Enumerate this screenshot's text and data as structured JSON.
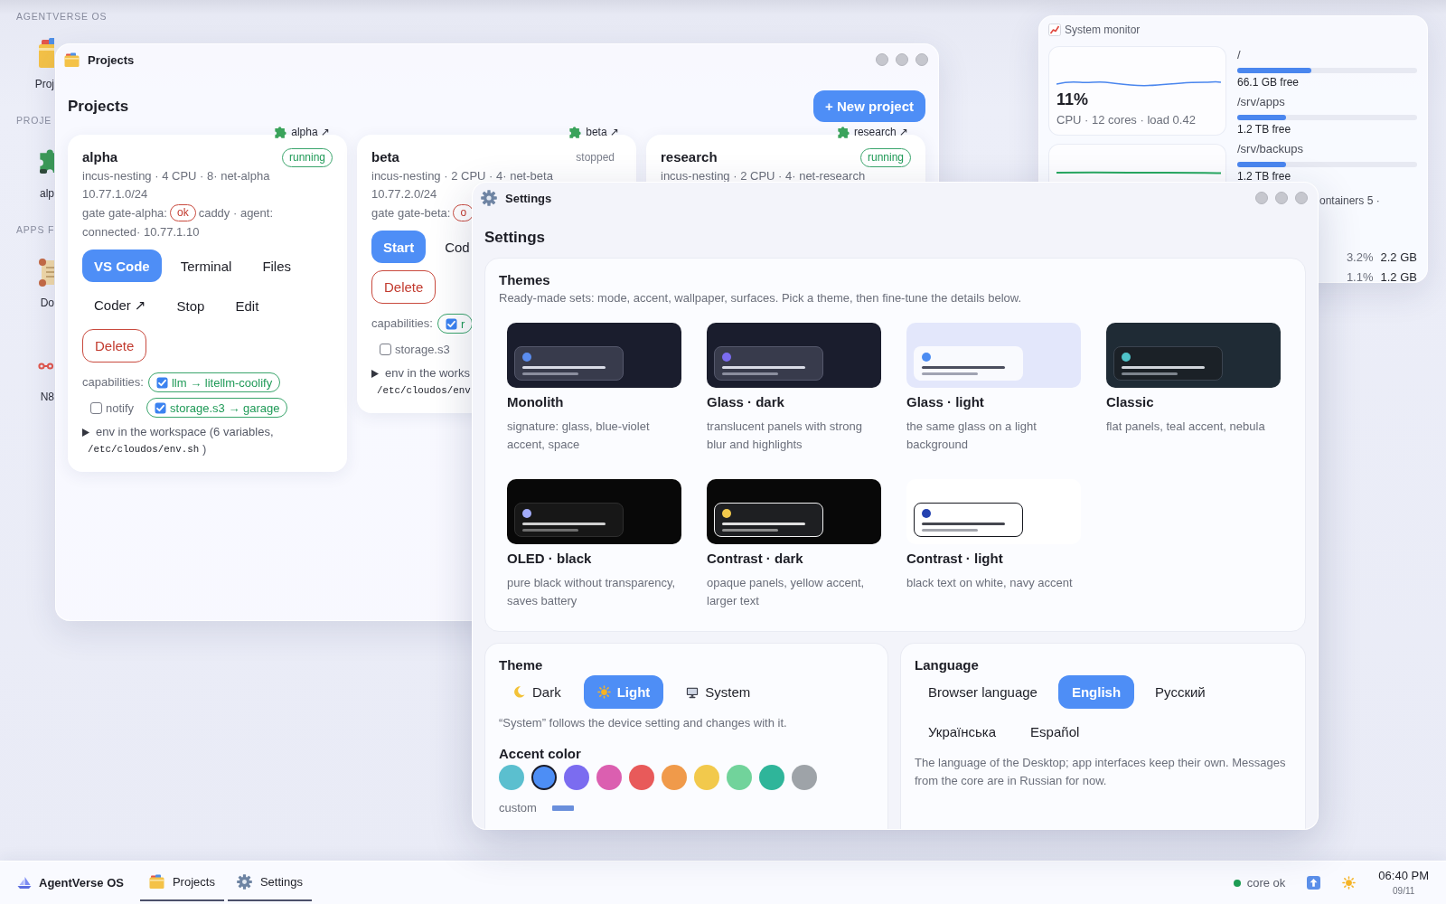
{
  "desktop": {
    "title": "AGENTVERSE OS",
    "entries": [
      {
        "kind": "folder",
        "label": "Proj"
      },
      {
        "kind": "heading",
        "label": "PROJE"
      },
      {
        "kind": "puzzle",
        "label": "alp"
      },
      {
        "kind": "heading",
        "label": "APPS F"
      },
      {
        "kind": "scroll",
        "label": "Do"
      },
      {
        "kind": "nodes",
        "label": "N8"
      }
    ]
  },
  "projects_window": {
    "title": "Projects",
    "heading": "Projects",
    "new_button": "+ New project",
    "projects": [
      {
        "name": "alpha",
        "link": "alpha ↗",
        "status": {
          "label": "running",
          "running": true
        },
        "specs": "incus-nesting · 4 CPU · 8· net-alpha",
        "subnet": "10.77.1.0/24",
        "gate": {
          "label": "gate gate-alpha:",
          "status": "ok",
          "details": [
            "caddy · agent:",
            "connected· 10.77.1.10"
          ]
        },
        "actions": [
          {
            "label": "VS Code",
            "kind": "primary"
          },
          {
            "label": "Terminal",
            "kind": "plain"
          },
          {
            "label": "Files",
            "kind": "plain"
          },
          {
            "label": "Coder ↗",
            "kind": "plain"
          },
          {
            "label": "Stop",
            "kind": "plain"
          },
          {
            "label": "Edit",
            "kind": "plain"
          },
          {
            "label": "Delete",
            "kind": "danger"
          }
        ],
        "capabilities": {
          "label": "capabilities:",
          "items": [
            {
              "label": "llm → litellm-coolify",
              "checked": true
            },
            {
              "label": "notify",
              "checked": false
            },
            {
              "label": "storage.s3 → garage",
              "checked": true
            }
          ]
        },
        "env": {
          "summary": "env in the workspace (6 variables,",
          "path": "/etc/cloudos/env.sh",
          "tail": ")",
          "expanded": false
        }
      },
      {
        "name": "beta",
        "link": "beta ↗",
        "status": {
          "label": "stopped",
          "running": false
        },
        "specs": "incus-nesting · 2 CPU · 4· net-beta",
        "subnet": "10.77.2.0/24",
        "gate": {
          "label": "gate gate-beta:",
          "status": "o"
        },
        "actions": [
          {
            "label": "Start",
            "kind": "primary"
          },
          {
            "label": "Cod",
            "kind": "plain"
          },
          {
            "label": "Delete",
            "kind": "danger"
          }
        ],
        "capabilities": {
          "label": "capabilities:",
          "items": [
            {
              "label": "r",
              "checked": true
            },
            {
              "label": "storage.s3",
              "checked": false
            }
          ]
        },
        "env": {
          "summary": "env in the works",
          "path": "/etc/cloudos/env",
          "expanded": false
        }
      },
      {
        "name": "research",
        "link": "research ↗",
        "status": {
          "label": "running",
          "running": true
        },
        "specs": "incus-nesting · 2 CPU · 4· net-research"
      }
    ]
  },
  "monitor": {
    "title": "System monitor",
    "cpu": {
      "value": "11%",
      "caption": "CPU · 12 cores · load 0.42"
    },
    "disks": [
      {
        "path": "/",
        "level": 0.41,
        "free": "66.1 GB free"
      },
      {
        "path": "/srv/apps",
        "level": 0.27,
        "free": "1.2 TB free"
      },
      {
        "path": "/srv/backups",
        "level": 0.27,
        "free": "1.2 TB free"
      }
    ],
    "containers": "ontainers 5 ·",
    "rows": [
      {
        "cells": [
          "3.2%",
          "2.2 GB"
        ]
      },
      {
        "cells": [
          "1.1%",
          "1.2 GB"
        ]
      }
    ]
  },
  "settings_window": {
    "title": "Settings",
    "heading": "Settings",
    "themes": {
      "title": "Themes",
      "description": "Ready-made sets: mode, accent, wallpaper, surfaces. Pick a theme, then fine-tune the details below.",
      "items": [
        {
          "name": "Monolith",
          "description": "signature: glass, blue-violet accent, space",
          "kind": "dark",
          "color": "#5b8def"
        },
        {
          "name": "Glass · dark",
          "description": "translucent panels with strong blur and highlights",
          "kind": "dark",
          "color": "#7b6cf0"
        },
        {
          "name": "Glass · light",
          "description": "the same glass on a light background",
          "kind": "light",
          "color": "#4c8cf2"
        },
        {
          "name": "Classic",
          "description": "flat panels, teal accent, nebula",
          "kind": "slate",
          "color": "#4fc3c9"
        },
        {
          "name": "OLED · black",
          "description": "pure black without transparency, saves battery",
          "kind": "black",
          "color": "#a3acfa"
        },
        {
          "name": "Contrast · dark",
          "description": "opaque panels, yellow accent, larger text",
          "kind": "contrast",
          "color": "#f2c94c"
        },
        {
          "name": "Contrast · light",
          "description": "black text on white, navy accent",
          "kind": "paper",
          "color": "#2341b0"
        }
      ]
    },
    "theme": {
      "title": "Theme",
      "options": [
        {
          "label": "Dark",
          "kind": "moon",
          "selected": false
        },
        {
          "label": "Light",
          "kind": "sun",
          "selected": true
        },
        {
          "label": "System",
          "kind": "monitor",
          "selected": false
        }
      ],
      "note": "“System” follows the device setting and changes with it.",
      "accent_title": "Accent color",
      "accents": [
        {
          "color": "#5bbfcf",
          "selected": false
        },
        {
          "color": "#4d8ef5",
          "selected": true
        },
        {
          "color": "#7b6cf0",
          "selected": false
        },
        {
          "color": "#db5fb0",
          "selected": false
        },
        {
          "color": "#e85a5a",
          "selected": false
        },
        {
          "color": "#f09a4a",
          "selected": false
        },
        {
          "color": "#f2c94c",
          "selected": false
        },
        {
          "color": "#71d39b",
          "selected": false
        },
        {
          "color": "#2fb59a",
          "selected": false
        },
        {
          "color": "#9ea3a8",
          "selected": false
        }
      ],
      "custom": {
        "label": "custom",
        "color": "#6a8fdc"
      }
    },
    "language": {
      "title": "Language",
      "options": [
        {
          "label": "Browser language",
          "selected": false
        },
        {
          "label": "English",
          "selected": true
        },
        {
          "label": "Русский",
          "selected": false
        },
        {
          "label": "Українська",
          "selected": false
        },
        {
          "label": "Español",
          "selected": false
        }
      ],
      "note": "The language of the Desktop; app interfaces keep their own. Messages from the core are in Russian for now."
    }
  },
  "taskbar": {
    "brand": "AgentVerse OS",
    "tasks": [
      {
        "label": "Projects",
        "kind": "folder",
        "open": true
      },
      {
        "label": "Settings",
        "kind": "gear",
        "open": true
      }
    ],
    "status": {
      "label": "core ok",
      "ok": true
    },
    "time": "06:40 PM",
    "date": "09/11"
  }
}
